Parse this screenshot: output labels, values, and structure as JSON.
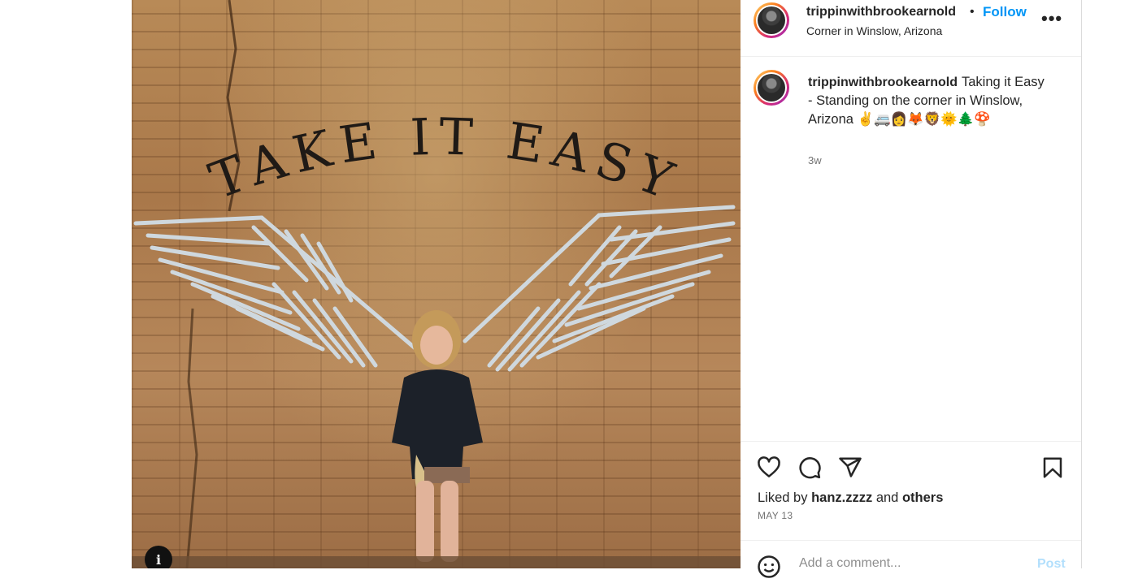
{
  "post": {
    "username": "trippinwithbrookearnold",
    "follow_label": "Follow",
    "separator": "•",
    "location": "Corner in Winslow, Arizona",
    "more_label": "•••",
    "caption": "Taking it Easy - Standing on the corner in Winslow, Arizona ✌️🚐👩🦊🦁🌞🌲🍄",
    "time_ago": "3w",
    "liked_by_prefix": "Liked by",
    "liked_by_user": "hanz.zzzz",
    "liked_by_and": "and",
    "liked_by_others": "others",
    "date": "MAY 13"
  },
  "photo": {
    "wall_text": "TAKE IT EASY",
    "info_label": "i"
  },
  "comment": {
    "placeholder": "Add a comment...",
    "post_label": "Post"
  },
  "icons": [
    "heart-icon",
    "comment-icon",
    "share-icon",
    "bookmark-icon",
    "emoji-icon",
    "more-icon"
  ],
  "colors": {
    "follow": "#0095f6",
    "post_disabled": "#b2dffc",
    "muted_text": "#737373"
  }
}
